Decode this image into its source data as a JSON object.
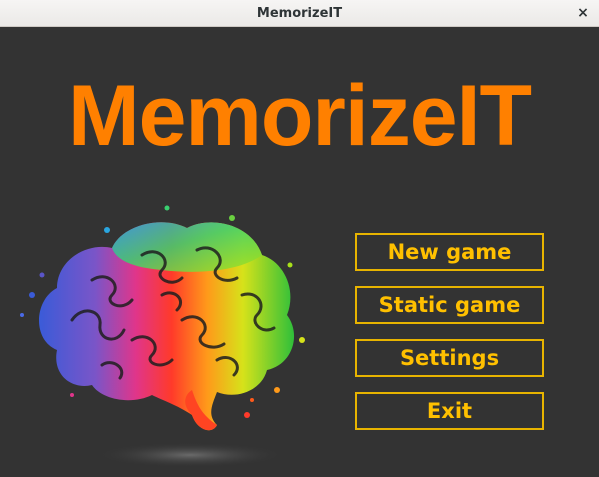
{
  "window": {
    "title": "MemorizeIT",
    "close_glyph": "×"
  },
  "app": {
    "title": "MemorizeIT",
    "title_color": "#ff8000"
  },
  "illustration": {
    "name": "rainbow-brain-illustration"
  },
  "menu": {
    "accent_color": "#ffc000",
    "items": [
      {
        "id": "new-game",
        "label": "New game"
      },
      {
        "id": "static-game",
        "label": "Static game"
      },
      {
        "id": "settings",
        "label": "Settings"
      },
      {
        "id": "exit",
        "label": "Exit"
      }
    ]
  }
}
